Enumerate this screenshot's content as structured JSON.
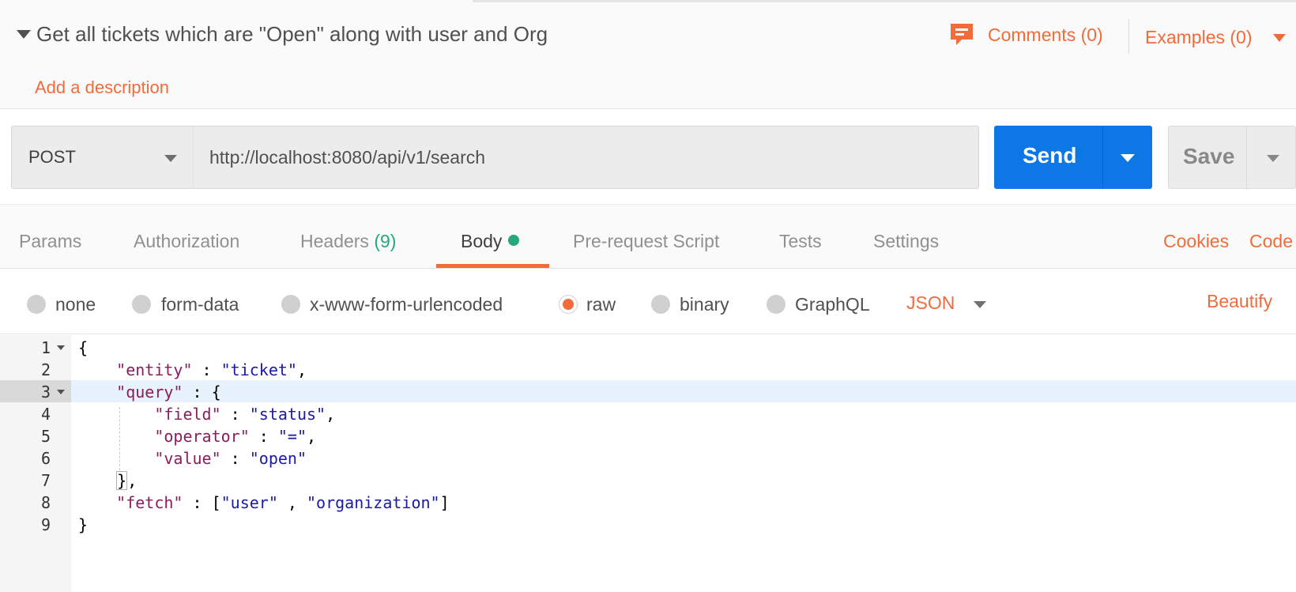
{
  "request": {
    "title": "Get all tickets which are \"Open\" along with user and Org",
    "add_description": "Add a description",
    "comments": "Comments (0)",
    "examples": "Examples (0)"
  },
  "url_bar": {
    "method": "POST",
    "url": "http://localhost:8080/api/v1/search",
    "send": "Send",
    "save": "Save"
  },
  "tabs": {
    "params": "Params",
    "authorization": "Authorization",
    "headers": "Headers",
    "headers_count": "(9)",
    "body": "Body",
    "pre_request": "Pre-request Script",
    "tests": "Tests",
    "settings": "Settings",
    "cookies": "Cookies",
    "code": "Code"
  },
  "body_types": {
    "none": "none",
    "form_data": "form-data",
    "urlencoded": "x-www-form-urlencoded",
    "raw": "raw",
    "binary": "binary",
    "graphql": "GraphQL",
    "selected": "raw",
    "format": "JSON",
    "beautify": "Beautify"
  },
  "editor": {
    "line_numbers": [
      "1",
      "2",
      "3",
      "4",
      "5",
      "6",
      "7",
      "8",
      "9"
    ],
    "highlighted_line": "3",
    "lines": {
      "l1": "{",
      "l2_key": "\"entity\"",
      "l2_sep": " : ",
      "l2_val": "\"ticket\"",
      "l2_end": ",",
      "l3_key": "\"query\"",
      "l3_end": " : {",
      "l4_key": "\"field\"",
      "l4_sep": " : ",
      "l4_val": "\"status\"",
      "l4_end": ",",
      "l5_key": "\"operator\"",
      "l5_sep": " : ",
      "l5_val": "\"=\"",
      "l5_end": ",",
      "l6_key": "\"value\"",
      "l6_sep": " : ",
      "l6_val": "\"open\"",
      "l7_brace": "}",
      "l7_end": ",",
      "l8_key": "\"fetch\"",
      "l8_sep": " : [",
      "l8_val1": "\"user\"",
      "l8_mid": " , ",
      "l8_val2": "\"organization\"",
      "l8_end": "]",
      "l9": "}"
    }
  },
  "colors": {
    "accent": "#f26b3a",
    "send_blue": "#0d77e6",
    "success_green": "#26a77c",
    "json_key": "#8a1d5c",
    "json_string": "#1a1aa6"
  }
}
